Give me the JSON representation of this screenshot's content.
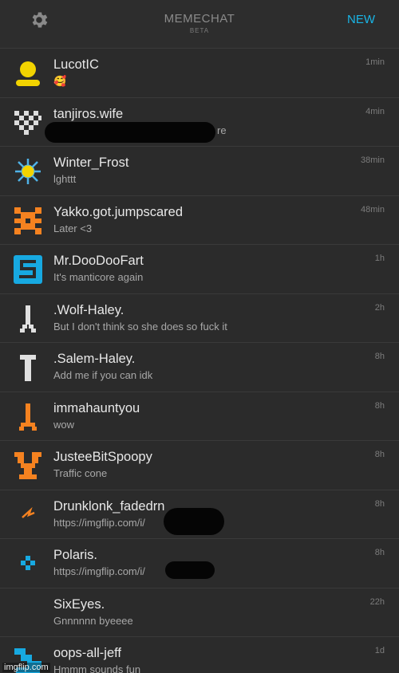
{
  "header": {
    "settings_icon": "gear-icon",
    "title": "MEMECHAT",
    "subtitle": "BETA",
    "new_label": "NEW",
    "accent": "#19b5e6"
  },
  "conversations": [
    {
      "name": "LucotIC",
      "message": "🥰",
      "time": "1min",
      "avatar": "yellow-person-icon",
      "color": "#f2d300"
    },
    {
      "name": "tanjiros.wife",
      "message": "re",
      "time": "4min",
      "avatar": "white-pixel-heart-icon",
      "color": "#dcdcdc"
    },
    {
      "name": "Winter_Frost",
      "message": "lghttt",
      "time": "38min",
      "avatar": "sun-icon",
      "color": "#4fb3e8"
    },
    {
      "name": "Yakko.got.jumpscared",
      "message": "Later <3",
      "time": "48min",
      "avatar": "orange-pixel-icon",
      "color": "#f58220"
    },
    {
      "name": "Mr.DooDooFart",
      "message": "It's manticore again",
      "time": "1h",
      "avatar": "blue-s-icon",
      "color": "#17a9e1"
    },
    {
      "name": ".Wolf-Haley.",
      "message": "But I don't think so she does so fuck it",
      "time": "2h",
      "avatar": "white-pixel-figure-icon",
      "color": "#e0e0e0"
    },
    {
      "name": ".Salem-Haley.",
      "message": "Add me if you can idk",
      "time": "8h",
      "avatar": "white-pixel-t-icon",
      "color": "#e0e0e0"
    },
    {
      "name": "immahauntyou",
      "message": "wow",
      "time": "8h",
      "avatar": "orange-pixel-figure-icon",
      "color": "#f58220"
    },
    {
      "name": "JusteeBitSpoopy",
      "message": "Traffic cone",
      "time": "8h",
      "avatar": "orange-pixel-y-icon",
      "color": "#f58220"
    },
    {
      "name": "Drunklonk_fadedrn",
      "message": "https://imgflip.com/i/",
      "time": "8h",
      "avatar": "orange-lightning-icon",
      "color": "#f58220"
    },
    {
      "name": "Polaris.",
      "message": "https://imgflip.com/i/",
      "time": "8h",
      "avatar": "blue-pixel-cross-icon",
      "color": "#17a9e1"
    },
    {
      "name": "SixEyes.",
      "message": "Gnnnnnn byeeee",
      "time": "22h",
      "avatar": "",
      "color": ""
    },
    {
      "name": "oops-all-jeff",
      "message": "Hmmm sounds fun",
      "time": "1d",
      "avatar": "blue-pixel-icon",
      "color": "#17a9e1"
    }
  ],
  "watermark": "imgflip.com"
}
